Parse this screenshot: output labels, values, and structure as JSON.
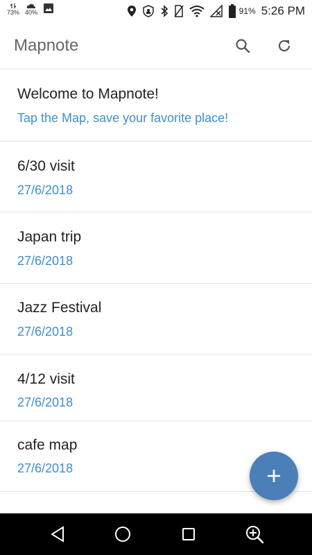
{
  "status_bar": {
    "left_mini_1": "73%",
    "left_mini_2": "40%",
    "battery_percent": "91%",
    "time": "5:26 PM",
    "icons": [
      "network-activity-icon",
      "weather-icon",
      "image-icon",
      "location-icon",
      "vpn-icon",
      "bluetooth-icon",
      "no-sim-icon",
      "wifi-icon",
      "signal-icon",
      "battery-icon"
    ]
  },
  "app_bar": {
    "title": "Mapnote",
    "actions": [
      "search-icon",
      "refresh-icon"
    ]
  },
  "notes": [
    {
      "title": "Welcome to Mapnote!",
      "subtitle": "Tap the Map, save your favorite place!"
    },
    {
      "title": "6/30 visit",
      "subtitle": "27/6/2018"
    },
    {
      "title": "Japan trip",
      "subtitle": "27/6/2018"
    },
    {
      "title": "Jazz Festival",
      "subtitle": "27/6/2018"
    },
    {
      "title": "4/12 visit",
      "subtitle": "27/6/2018"
    },
    {
      "title": "cafe map",
      "subtitle": "27/6/2018"
    }
  ],
  "fab": {
    "icon": "plus-icon"
  },
  "nav_bar": {
    "buttons": [
      "back-icon",
      "home-icon",
      "recents-icon",
      "zoom-icon"
    ]
  },
  "colors": {
    "accent": "#3d8fd1",
    "fab": "#4b7fb8",
    "divider": "#e4e4e4",
    "title": "#666666"
  }
}
